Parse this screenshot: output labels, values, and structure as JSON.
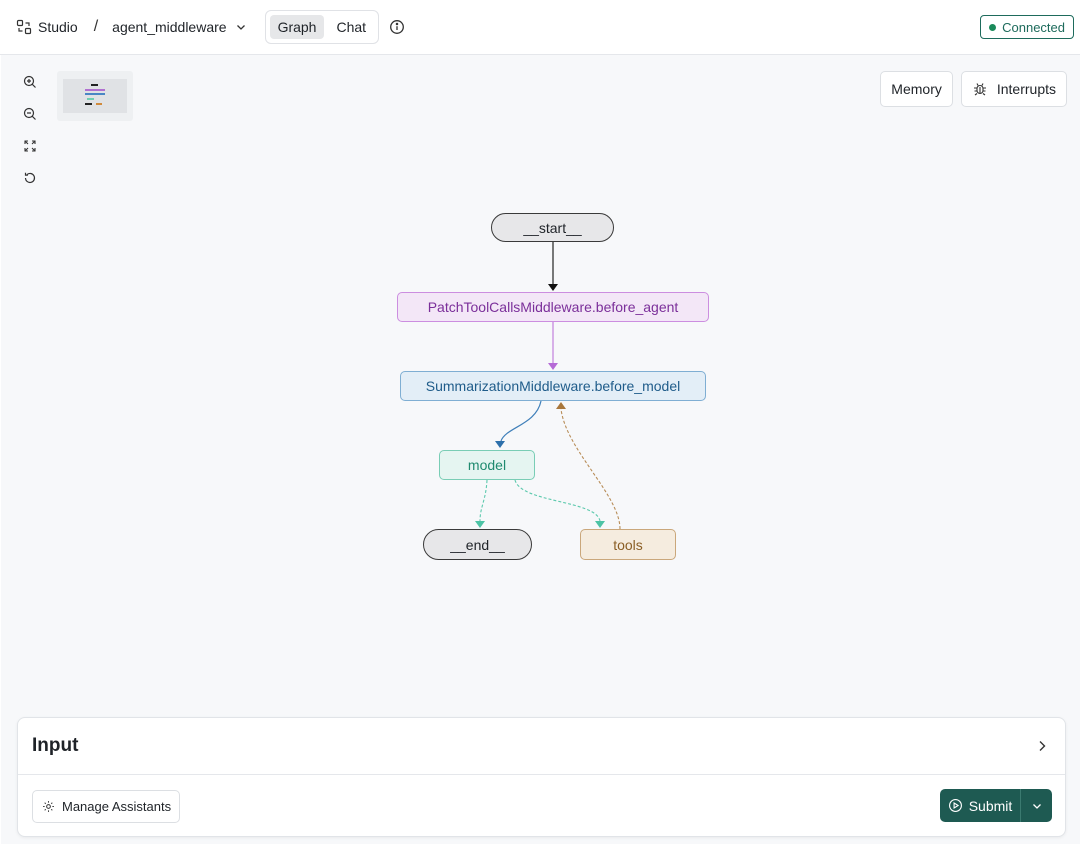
{
  "header": {
    "studio_label": "Studio",
    "separator": "/",
    "project_name": "agent_middleware",
    "tabs": [
      {
        "label": "Graph",
        "active": true
      },
      {
        "label": "Chat",
        "active": false
      }
    ],
    "status_label": "Connected",
    "status_color": "#1a8a5a"
  },
  "canvas": {
    "buttons": {
      "memory": "Memory",
      "interrupts": "Interrupts"
    },
    "nodes": {
      "start": "__start__",
      "patch": "PatchToolCallsMiddleware.before_agent",
      "summarization": "SummarizationMiddleware.before_model",
      "model": "model",
      "end": "__end__",
      "tools": "tools"
    },
    "icons": [
      "zoom-in-icon",
      "zoom-out-icon",
      "fit-view-icon",
      "reset-icon"
    ]
  },
  "input_panel": {
    "title": "Input",
    "manage_label": "Manage Assistants",
    "submit_label": "Submit",
    "accent": "#1e5a52"
  }
}
